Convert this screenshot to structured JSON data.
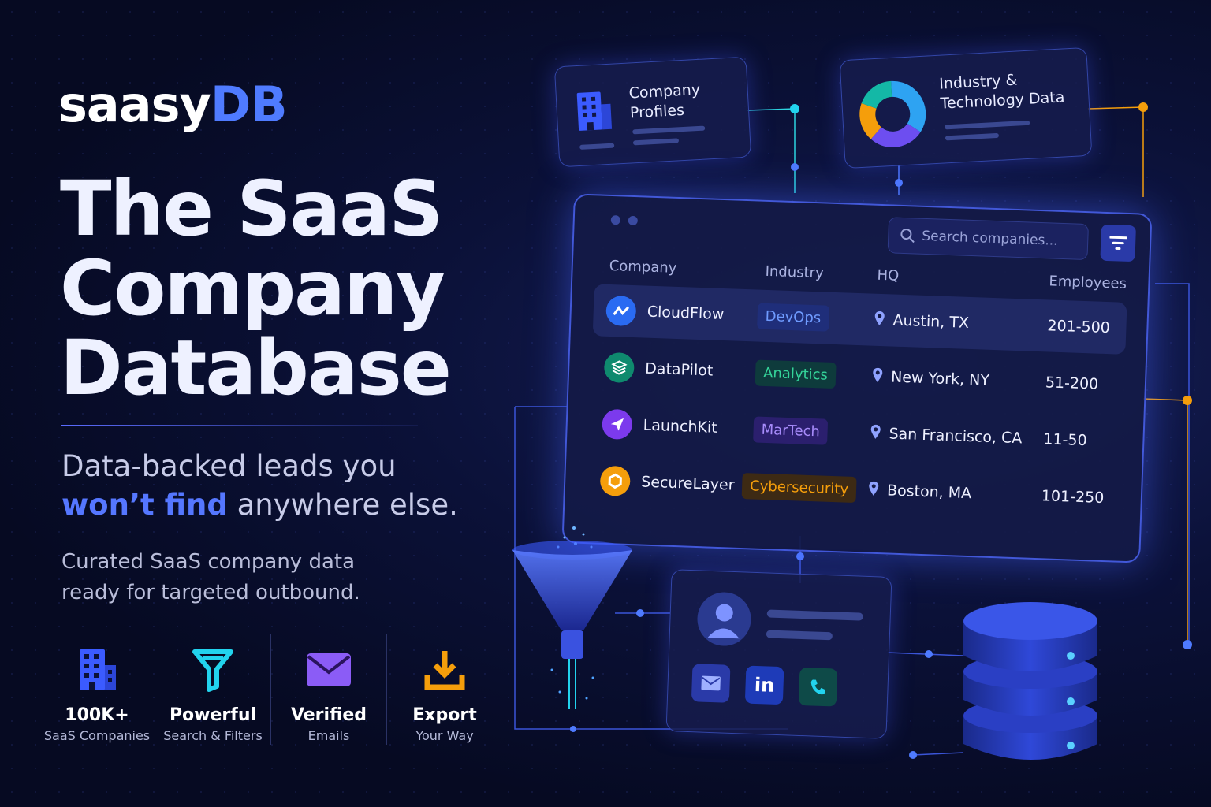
{
  "brand": {
    "name_prefix": "saasy",
    "name_suffix": "DB"
  },
  "hero": {
    "line1": "The SaaS",
    "line2": "Company",
    "line3": "Database"
  },
  "tagline": {
    "part1": "Data-backed leads you",
    "highlight": "won’t find",
    "part2": "anywhere else."
  },
  "subtitle": {
    "line1": "Curated SaaS company data",
    "line2": "ready for targeted outbound."
  },
  "features": [
    {
      "title": "100K+",
      "desc": "SaaS Companies",
      "icon": "building-icon"
    },
    {
      "title": "Powerful",
      "desc": "Search & Filters",
      "icon": "funnel-icon"
    },
    {
      "title": "Verified",
      "desc": "Emails",
      "icon": "envelope-icon"
    },
    {
      "title": "Export",
      "desc": "Your Way",
      "icon": "download-icon"
    }
  ],
  "cards": {
    "company_profiles": {
      "line1": "Company",
      "line2": "Profiles"
    },
    "industry": {
      "line1": "Industry &",
      "line2": "Technology Data"
    }
  },
  "table": {
    "search_placeholder": "Search companies...",
    "headers": {
      "company": "Company",
      "industry": "Industry",
      "hq": "HQ",
      "employees": "Employees"
    },
    "rows": [
      {
        "company": "CloudFlow",
        "industry": "DevOps",
        "hq": "Austin, TX",
        "employees": "201-500"
      },
      {
        "company": "DataPilot",
        "industry": "Analytics",
        "hq": "New York, NY",
        "employees": "51-200"
      },
      {
        "company": "LaunchKit",
        "industry": "MarTech",
        "hq": "San Francisco, CA",
        "employees": "11-50"
      },
      {
        "company": "SecureLayer",
        "industry": "Cybersecurity",
        "hq": "Boston, MA",
        "employees": "101-250"
      }
    ]
  },
  "contact": {
    "social": [
      "envelope-icon",
      "linkedin-icon",
      "phone-icon"
    ],
    "linkedin_text": "in"
  },
  "colors": {
    "background": "#070b24",
    "accent": "#4f7bff",
    "cyan": "#22d3ee",
    "orange": "#f59e0b",
    "purple": "#8b5cf6",
    "green": "#10b981"
  }
}
